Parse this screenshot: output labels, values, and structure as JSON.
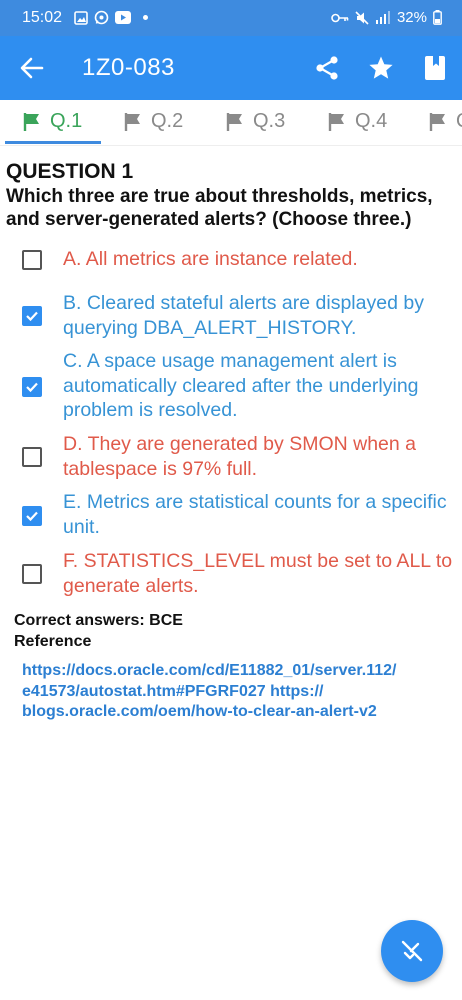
{
  "status_bar": {
    "time": "15:02",
    "battery": "32%",
    "left_icons": [
      "gallery-icon",
      "whatsapp-icon",
      "youtube-icon",
      "dot-icon"
    ],
    "right_icons": [
      "key-icon",
      "mute-icon",
      "signal-icon",
      "battery-icon"
    ]
  },
  "app_bar": {
    "title": "1Z0-083",
    "icons": [
      "back-arrow-icon",
      "share-icon",
      "star-icon",
      "bookmark-icon"
    ]
  },
  "tabs": [
    {
      "label": "Q.1",
      "active": true
    },
    {
      "label": "Q.2",
      "active": false
    },
    {
      "label": "Q.3",
      "active": false
    },
    {
      "label": "Q.4",
      "active": false
    },
    {
      "label": "Q",
      "active": false
    }
  ],
  "question": {
    "heading": "QUESTION 1",
    "text": "Which three are true about thresholds, metrics, and server-generated alerts? (Choose three.)"
  },
  "options": [
    {
      "text": "A.  All metrics are instance related.",
      "checked": false,
      "correct": false
    },
    {
      "text": "B.  Cleared stateful alerts are displayed by querying DBA_ALERT_HISTORY.",
      "checked": true,
      "correct": true
    },
    {
      "text": "C.  A space usage management alert is automatically cleared after the underlying problem is resolved.",
      "checked": true,
      "correct": true
    },
    {
      "text": "D.  They are generated by SMON when a tablespace is 97% full.",
      "checked": false,
      "correct": false
    },
    {
      "text": "E.  Metrics are statistical counts for a specific unit.",
      "checked": true,
      "correct": true
    },
    {
      "text": "F.  STATISTICS_LEVEL must be set to ALL to generate alerts.",
      "checked": false,
      "correct": false
    }
  ],
  "answers": "Correct answers: BCE",
  "reference_label": "Reference",
  "reference_links": "https://docs.oracle.com/cd/E11882_01/server.112/ e41573/autostat.htm#PFGRF027 https:// blogs.oracle.com/oem/how-to-clear-an-alert-v2",
  "colors": {
    "app_bar": "#2f8ef0",
    "status_bar": "#3e8bdf",
    "correct": "#3793d5",
    "wrong": "#e05a4a",
    "active_tab": "#3aa45a"
  }
}
